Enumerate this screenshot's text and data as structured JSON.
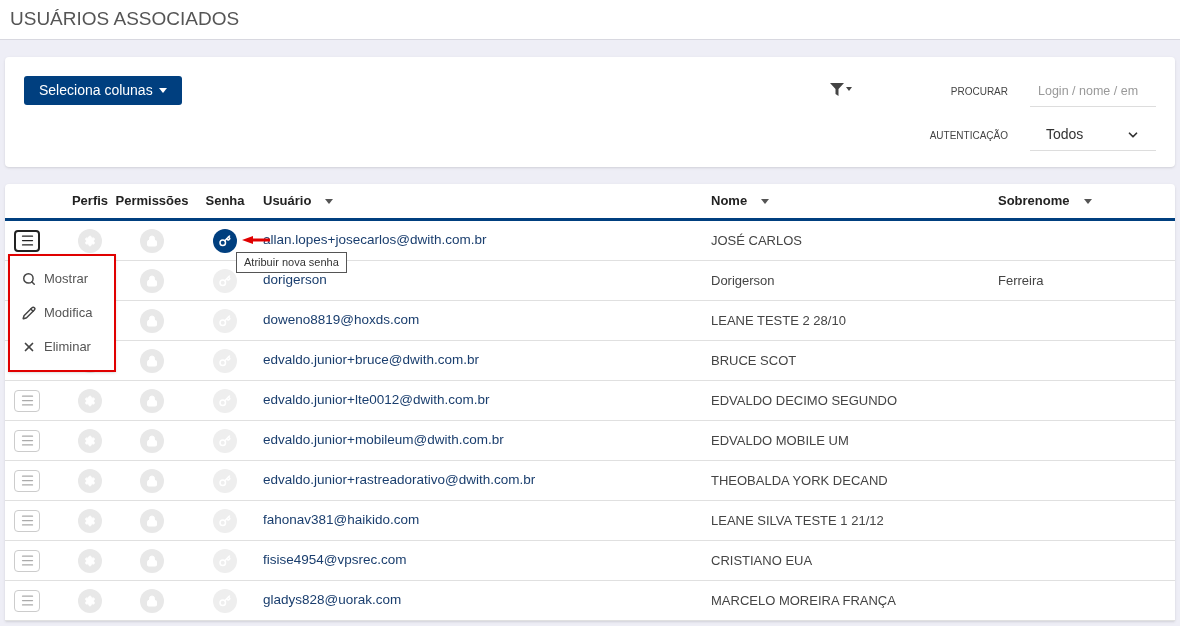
{
  "page_title": "USUÁRIOS ASSOCIADOS",
  "toolbar": {
    "columns_button": "Seleciona colunas",
    "search_label": "PROCURAR",
    "search_placeholder": "Login / nome / em",
    "auth_label": "AUTENTICAÇÃO",
    "auth_value": "Todos"
  },
  "table": {
    "columns": [
      {
        "label": "Perfis",
        "sortable": false
      },
      {
        "label": "Permissões",
        "sortable": false
      },
      {
        "label": "Senha",
        "sortable": false
      },
      {
        "label": "Usuário",
        "sortable": true
      },
      {
        "label": "Nome",
        "sortable": true
      },
      {
        "label": "Sobrenome",
        "sortable": true
      }
    ],
    "rows": [
      {
        "usuario": "allan.lopes+josecarlos@dwith.com.br",
        "nome": "JOSÉ CARLOS",
        "sobrenome": "",
        "password_active": true
      },
      {
        "usuario": "dorigerson",
        "nome": "Dorigerson",
        "sobrenome": "Ferreira",
        "password_active": false
      },
      {
        "usuario": "doweno8819@hoxds.com",
        "nome": "LEANE TESTE 2 28/10",
        "sobrenome": "",
        "password_active": false
      },
      {
        "usuario": "edvaldo.junior+bruce@dwith.com.br",
        "nome": "BRUCE SCOT",
        "sobrenome": "",
        "password_active": false
      },
      {
        "usuario": "edvaldo.junior+lte0012@dwith.com.br",
        "nome": "EDVALDO DECIMO SEGUNDO",
        "sobrenome": "",
        "password_active": false
      },
      {
        "usuario": "edvaldo.junior+mobileum@dwith.com.br",
        "nome": "EDVALDO MOBILE UM",
        "sobrenome": "",
        "password_active": false
      },
      {
        "usuario": "edvaldo.junior+rastreadorativo@dwith.com.br",
        "nome": "THEOBALDA YORK DECAND",
        "sobrenome": "",
        "password_active": false
      },
      {
        "usuario": "fahonav381@haikido.com",
        "nome": "LEANE SILVA TESTE 1 21/12",
        "sobrenome": "",
        "password_active": false
      },
      {
        "usuario": "fisise4954@vpsrec.com",
        "nome": "CRISTIANO EUA",
        "sobrenome": "",
        "password_active": false
      },
      {
        "usuario": "gladys828@uorak.com",
        "nome": "MARCELO MOREIRA FRANÇA",
        "sobrenome": "",
        "password_active": false
      }
    ]
  },
  "row_menu": {
    "open": true,
    "items": [
      {
        "kind": "show",
        "label": "Mostrar"
      },
      {
        "kind": "edit",
        "label": "Modifica"
      },
      {
        "kind": "delete",
        "label": "Eliminar"
      }
    ]
  },
  "tooltip": "Atribuir nova senha"
}
